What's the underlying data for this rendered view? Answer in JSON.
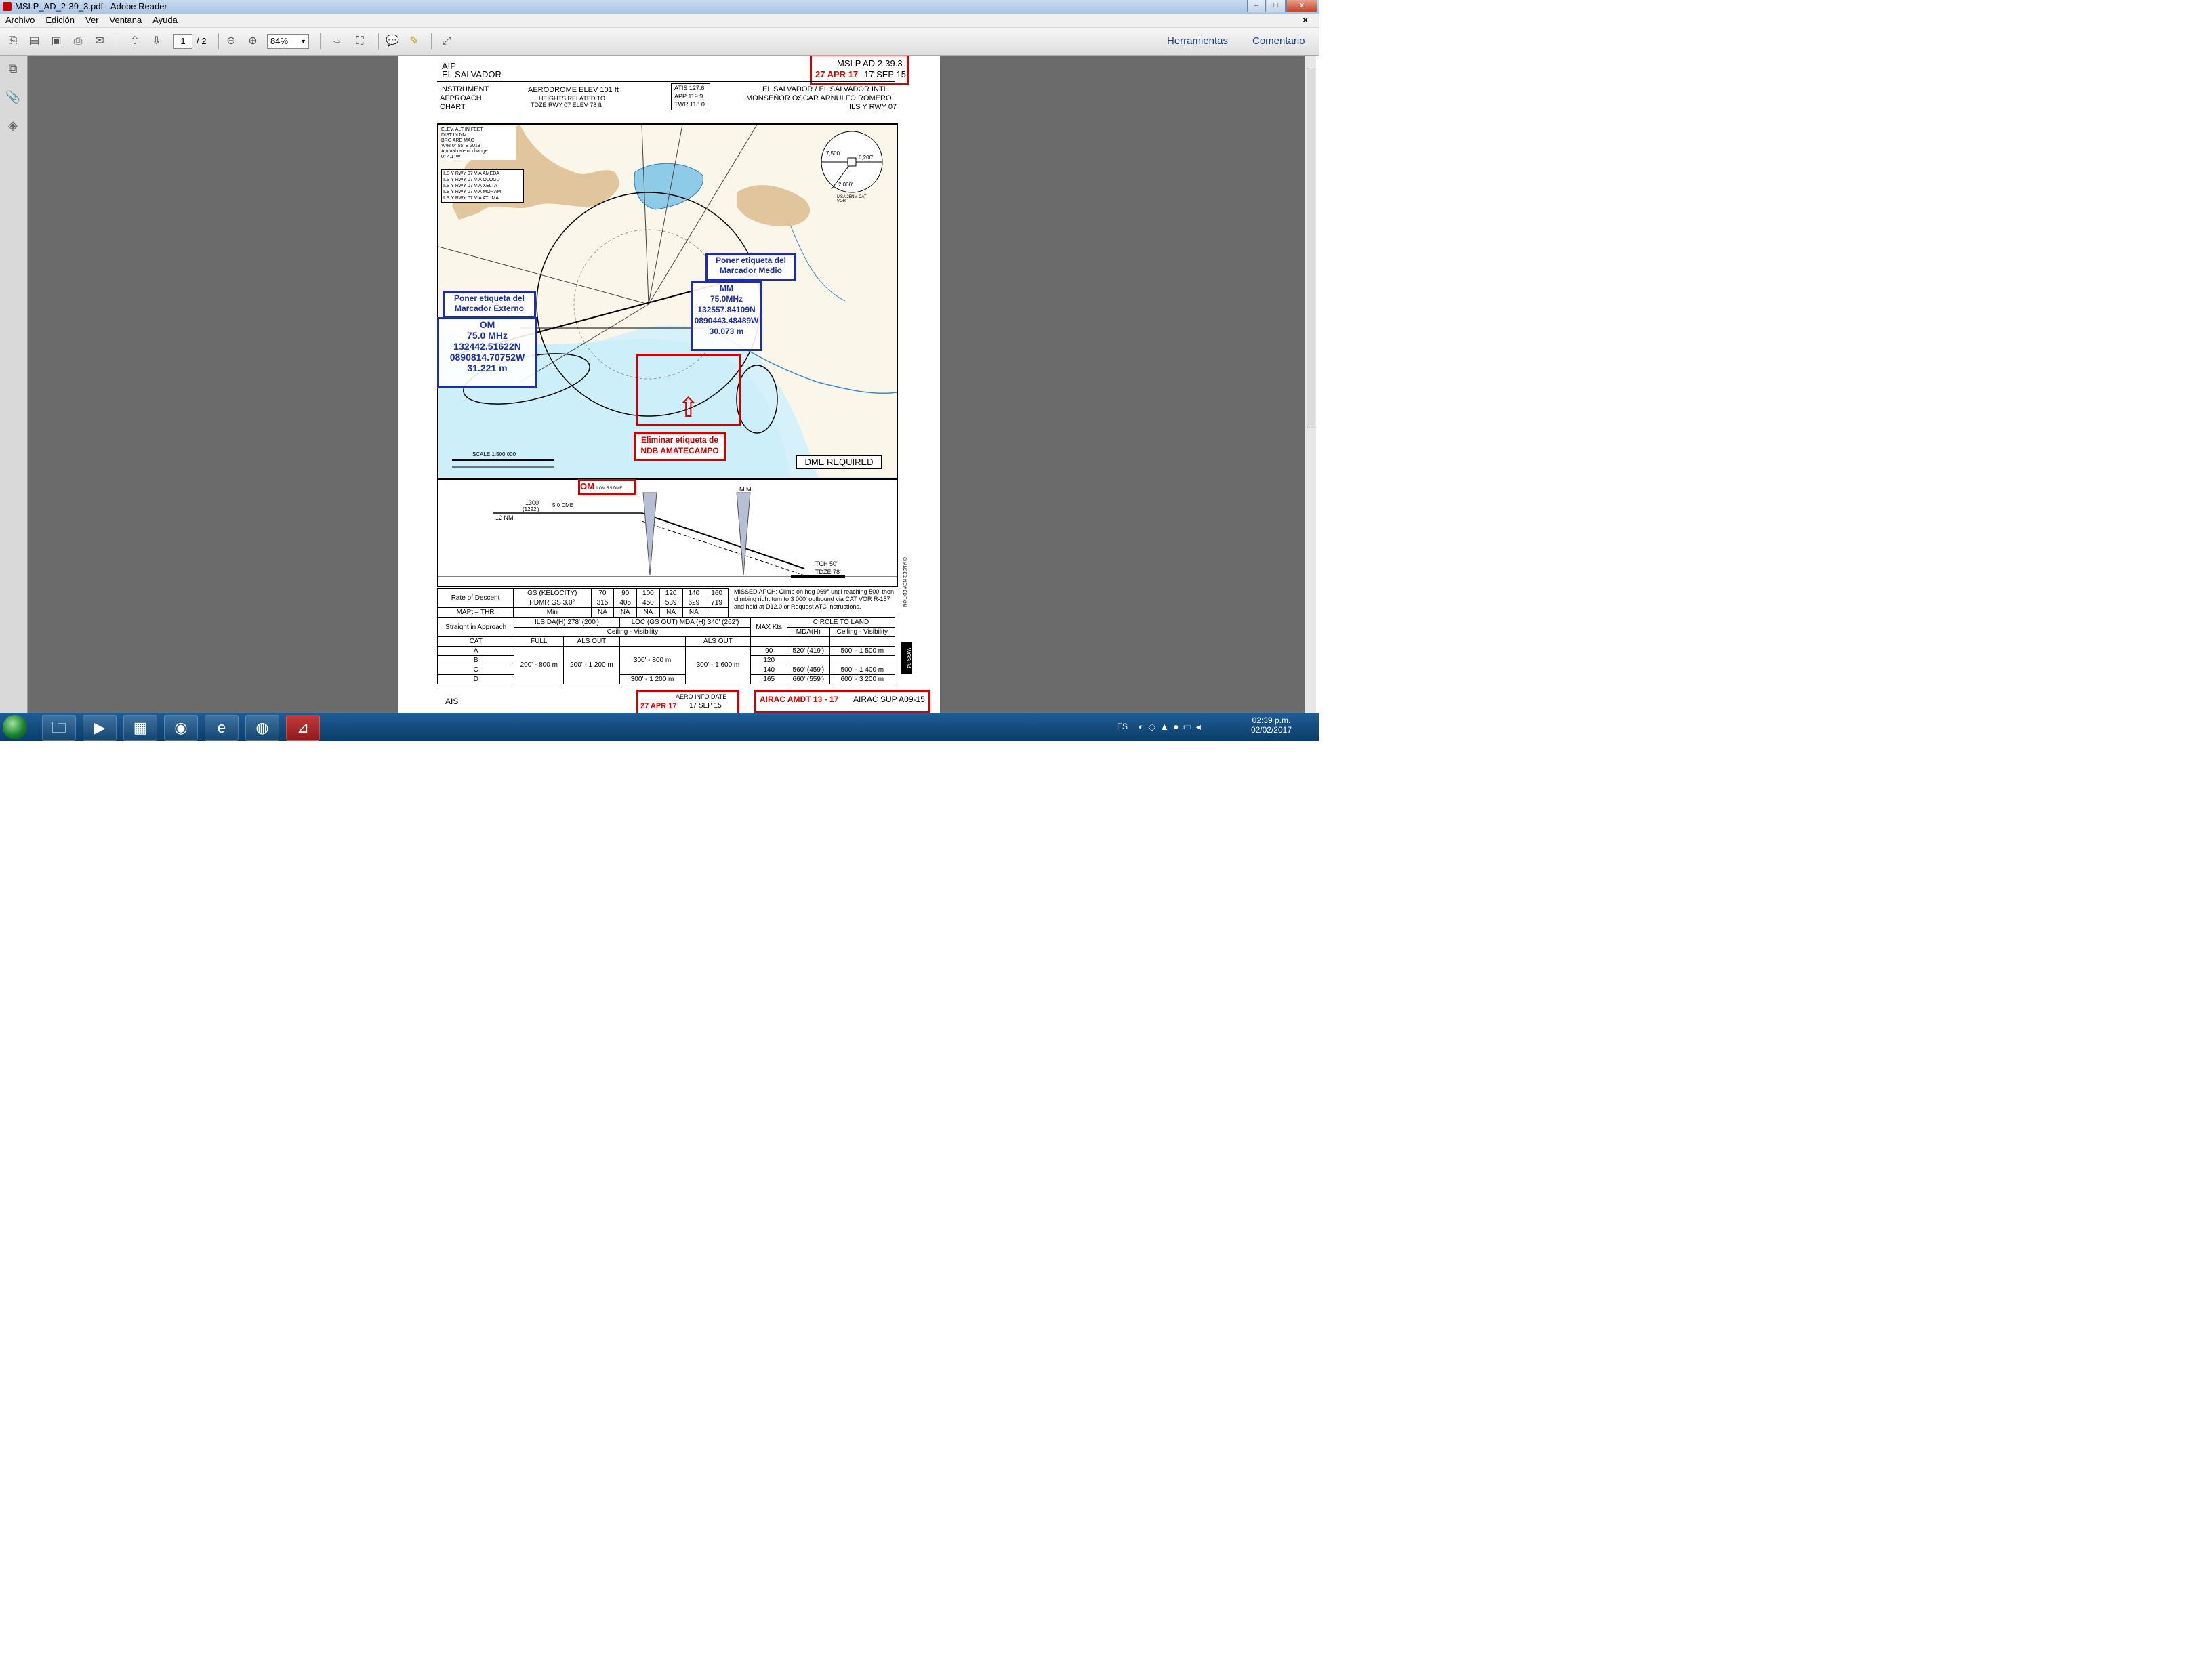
{
  "window": {
    "title": "MSLP_AD_2-39_3.pdf - Adobe Reader",
    "min": "–",
    "max": "□",
    "close": "x"
  },
  "menu": [
    "Archivo",
    "Edición",
    "Ver",
    "Ventana",
    "Ayuda"
  ],
  "menu_close": "×",
  "toolbar": {
    "page_current": "1",
    "page_total": "/ 2",
    "zoom": "84%",
    "tools_label": "Herramientas",
    "comment_label": "Comentario"
  },
  "doc": {
    "aip": "AIP",
    "country": "EL SALVADOR",
    "page_id": "MSLP AD 2-39.3",
    "date_red": "27 APR 17",
    "date_black": "17 SEP 15",
    "chart_type": [
      "INSTRUMENT",
      "APPROACH",
      "CHART"
    ],
    "aerodrome_elev": "AERODROME ELEV  101 ft",
    "heights_related": "HEIGHTS RELATED TO",
    "tdze": "TDZE RWY 07 ELEV 78 ft",
    "freqs": [
      "ATIS    127.6",
      "APP     119.9",
      "TWR     118.0"
    ],
    "airport": [
      "EL SALVADOR / EL SALVADOR  INTL",
      "MONSEÑOR OSCAR ARNULFO ROMERO",
      "ILS Y RWY 07"
    ],
    "legend": [
      "ELEV, ALT IN FEET",
      "DIST IN NM",
      "BRG ARE MAG",
      "VAR 0° 55' E 2013",
      "Annual rate of change",
      "0° 4.1' W"
    ],
    "transitions": [
      "ILS Y RWY 07 VIA AMEDA",
      "ILS Y RWY 07 VIA OLOGU",
      "ILS Y RWY 07 VIA XELTA",
      "ILS Y RWY 07 VIA MORAM",
      "ILS Y RWY 07 VIA ATUMA"
    ],
    "msa": {
      "n": "7,500'",
      "e": "6,200'",
      "s": "2,000'",
      "label": "MSA 25NM CAT VOR"
    },
    "scale": "SCALE  1:500,000",
    "dme_required": "DME REQUIRED",
    "note_om_label": "Poner etiqueta del Marcador Externo",
    "om_box": [
      "OM",
      "75.0 MHz",
      "132442.51622N",
      "0890814.70752W",
      "31.221 m"
    ],
    "note_mm_label": "Poner etiqueta del Marcador Medio",
    "mm_box": [
      "MM",
      "75.0MHz",
      "132557.84109N",
      "0890443.48489W",
      "30.073 m"
    ],
    "note_ndb": "Eliminar etiqueta de NDB AMATECAMPO",
    "profile": {
      "om_tag": "OM",
      "om_sub": "LOM 5.5 DME",
      "mm_tag": "M M",
      "alt1": "1300'",
      "alt1b": "(1222')",
      "dme": "5.0 DME",
      "nm12": "12 NM",
      "tch": "TCH 50'",
      "tdze": "TDZE 78'"
    },
    "rod": {
      "header": [
        "Rate of Descent",
        "GS (KELOCITY)",
        "70",
        "90",
        "100",
        "120",
        "140",
        "160"
      ],
      "row1": [
        "PDMR GS 3.0°",
        "315",
        "405",
        "450",
        "539",
        "629",
        "719"
      ],
      "row2": [
        "MAPt – THR",
        "Min",
        "NA",
        "NA",
        "NA",
        "NA",
        "NA"
      ]
    },
    "missed": "MISSED APCH: Climb on hdg 069° until reaching 500' then climbing right turn to 3 000' outbound via CAT VOR R-157 and hold at D12.0 or Request ATC instructions.",
    "minima": {
      "sia": "Straight in Approach",
      "ils": "ILS DA(H) 278' (200')",
      "loc": "LOC (GS OUT) MDA (H) 340' (262')",
      "cv": "Ceiling - Visibility",
      "cols": [
        "CAT",
        "FULL",
        "ALS OUT",
        "",
        "ALS OUT"
      ],
      "cats": [
        "A",
        "B",
        "C",
        "D"
      ],
      "full": "200' - 800 m",
      "als1": "200' - 1 200 m",
      "loc1": "300' - 800 m",
      "loc2": "300' - 1 200 m",
      "als2": "300' - 1 600 m",
      "maxkts": "MAX Kts",
      "ctl": "CIRCLE TO LAND",
      "mda": "MDA(H)",
      "cv2": "Ceiling - Visibility",
      "speeds": [
        "90",
        "120",
        "140",
        "165"
      ],
      "mdas": [
        "520' (419')",
        "",
        "560' (459')",
        "660' (559')"
      ],
      "vis": [
        "500' - 1 500 m",
        "",
        "500' - 1 400 m",
        "600' - 3 200 m"
      ]
    },
    "wgs": "WGS 84",
    "side_changes": "CHANGES: NEW EDITION",
    "footer_ais": "AIS",
    "footer_aero": "AERO INFO DATE",
    "footer_red": "AIRAC AMDT 13 - 17",
    "footer_sup": "AIRAC SUP A09-15"
  },
  "taskbar": {
    "lang": "ES",
    "time": "02:39 p.m.",
    "date": "02/02/2017"
  }
}
